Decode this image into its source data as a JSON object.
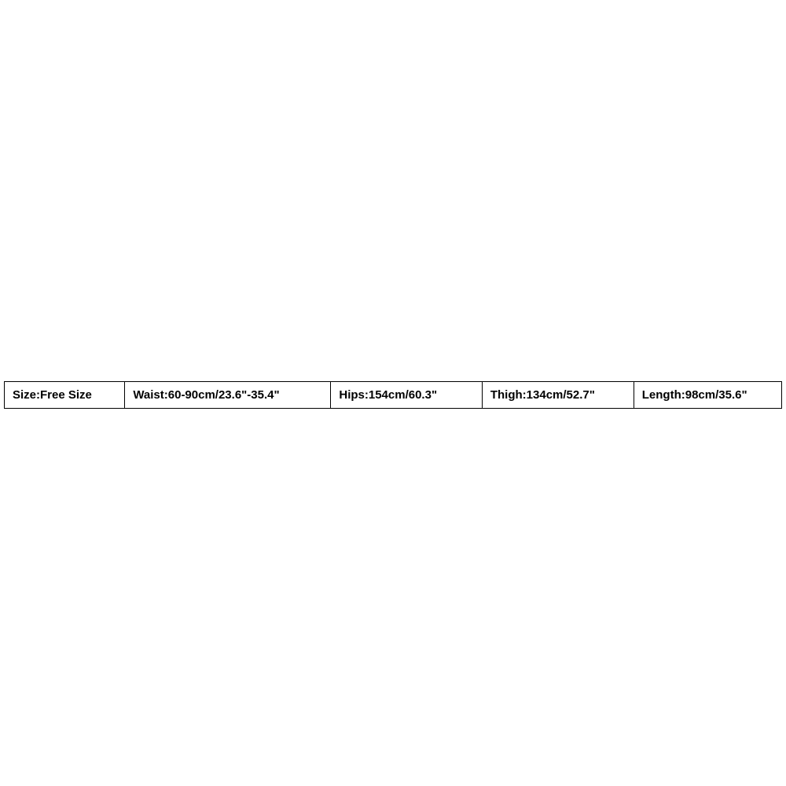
{
  "sizing": {
    "cells": [
      "Size:Free Size",
      "Waist:60-90cm/23.6\"-35.4\"",
      "Hips:154cm/60.3\"",
      "Thigh:134cm/52.7\"",
      "Length:98cm/35.6\""
    ]
  }
}
